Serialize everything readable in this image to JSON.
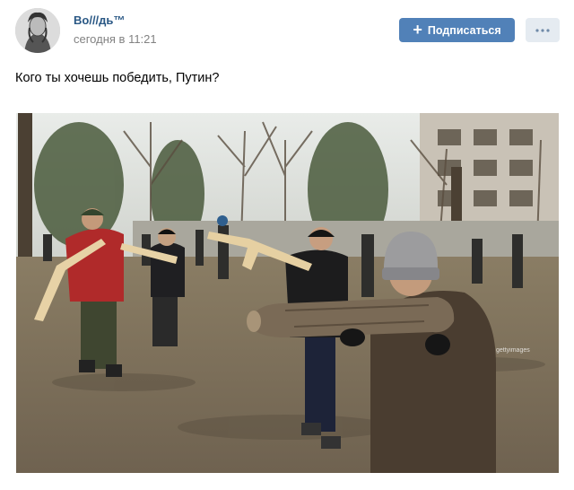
{
  "post": {
    "author": "Во///дь™",
    "time": "сегодня в 11:21",
    "text": "Кого ты хочешь победить, Путин?"
  },
  "actions": {
    "subscribe_label": "Подписаться",
    "subscribe_icon": "plus-icon",
    "more_icon": "more-dots-icon"
  },
  "photo": {
    "watermark": "gettyimages"
  },
  "colors": {
    "link": "#2a5885",
    "accent_button": "#5181b8",
    "muted_text": "#828282",
    "secondary_button": "#e5ebf1"
  }
}
